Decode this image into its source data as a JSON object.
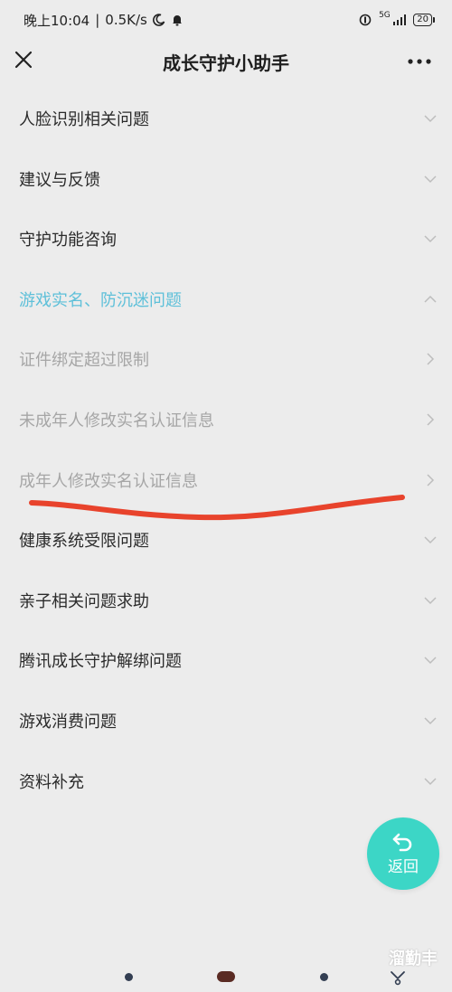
{
  "status_bar": {
    "time": "晚上10:04",
    "speed": "0.5K/s",
    "network": "5G",
    "battery": "20"
  },
  "header": {
    "title": "成长守护小助手"
  },
  "menu": [
    {
      "label": "人脸识别相关问题",
      "state": "collapsed"
    },
    {
      "label": "建议与反馈",
      "state": "collapsed"
    },
    {
      "label": "守护功能咨询",
      "state": "collapsed"
    },
    {
      "label": "游戏实名、防沉迷问题",
      "state": "expanded"
    },
    {
      "label": "证件绑定超过限制",
      "state": "sub"
    },
    {
      "label": "未成年人修改实名认证信息",
      "state": "sub"
    },
    {
      "label": "成年人修改实名认证信息",
      "state": "sub"
    },
    {
      "label": "健康系统受限问题",
      "state": "collapsed"
    },
    {
      "label": "亲子相关问题求助",
      "state": "collapsed"
    },
    {
      "label": "腾讯成长守护解绑问题",
      "state": "collapsed"
    },
    {
      "label": "游戏消费问题",
      "state": "collapsed"
    },
    {
      "label": "资料补充",
      "state": "collapsed"
    }
  ],
  "fab": {
    "label": "返回",
    "color": "#3cd6c6"
  },
  "watermark": "溜勤丰",
  "colors": {
    "background": "#ececec",
    "accent": "#5ec0d9",
    "muted": "#a6a6a6",
    "strike": "#e8432c"
  },
  "icons": {
    "close": "close-icon",
    "more": "more-icon",
    "expand": "chevron-down-icon",
    "collapse": "chevron-up-icon",
    "forward": "chevron-right-icon",
    "back": "return-arrow-icon"
  }
}
